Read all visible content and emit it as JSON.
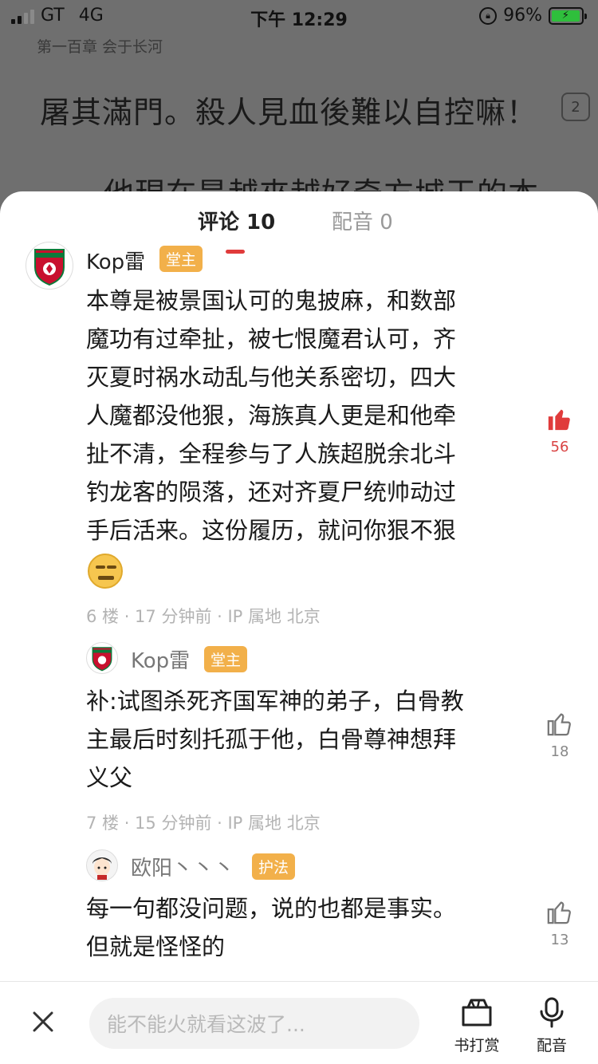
{
  "status_bar": {
    "carrier": "GT",
    "network": "4G",
    "time": "下午 12:29",
    "battery": "96%"
  },
  "reader": {
    "chapter": "第一百章 会于长河",
    "line1": "屠其滿門。殺人見血後難以自控嘛！",
    "line1_badge": "2",
    "line2": "他現在是越來越好奇方城王的本"
  },
  "tabs": {
    "comments": "评论 10",
    "dubbing": "配音 0"
  },
  "comments": [
    {
      "user": "Kop雷",
      "role": "堂主",
      "lines": [
        "本尊是被景国认可的鬼披麻，和数部",
        "魔功有过牵扯，被七恨魔君认可，齐",
        "灭夏时祸水动乱与他关系密切，四大",
        "人魔都没他狠，海族真人更是和他牵",
        "扯不清，全程参与了人族超脱余北斗",
        "钓龙客的陨落，还对齐夏尸统帅动过",
        "手后活来。这份履历，就问你狠不狠"
      ],
      "meta": "6 楼 · 17 分钟前 · IP 属地 北京",
      "likes": "56"
    },
    {
      "user": "Kop雷",
      "role": "堂主",
      "lines": [
        "补:试图杀死齐国军神的弟子，白骨教",
        "主最后时刻托孤于他，白骨尊神想拜",
        "义父"
      ],
      "meta": "7 楼 · 15 分钟前 · IP 属地 北京",
      "likes": "18"
    },
    {
      "user": "欧阳丶丶丶",
      "role": "护法",
      "lines": [
        "每一句都没问题，说的也都是事实。",
        "但就是怪怪的"
      ],
      "likes": "13"
    }
  ],
  "bottom_bar": {
    "input_placeholder": "能不能火就看这波了...",
    "reward_label": "书打赏",
    "dub_label": "配音"
  },
  "colors": {
    "accent_red": "#e03b3b",
    "role_badge": "#f2b04a",
    "like_hot": "#d94343"
  },
  "icons": [
    "close-icon",
    "thumbs-up-icon",
    "wallet-icon",
    "microphone-icon",
    "liverpool-crest-avatar",
    "squint-smile-emoji"
  ]
}
